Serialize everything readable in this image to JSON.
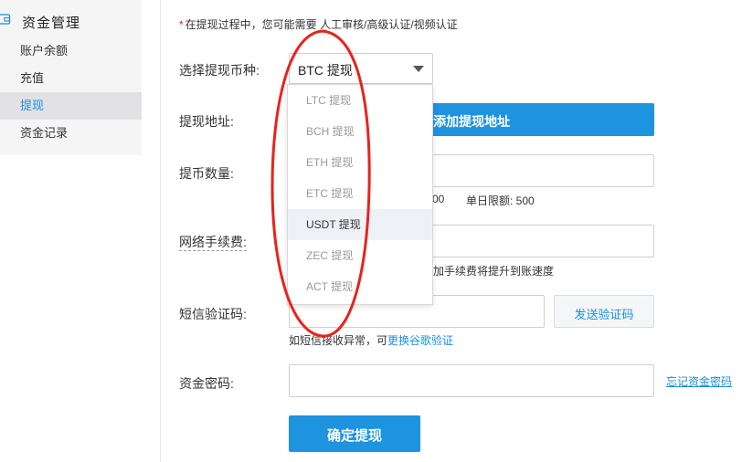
{
  "sidebar": {
    "title": "资金管理",
    "items": [
      {
        "label": "账户余额"
      },
      {
        "label": "充值"
      },
      {
        "label": "提现"
      },
      {
        "label": "资金记录"
      }
    ]
  },
  "form": {
    "notice_star": "*",
    "notice": "在提现过程中，您可能需要 人工审核/高级认证/视频认证",
    "currency_label": "选择提现币种:",
    "currency_value": "BTC 提现",
    "currency_options": [
      "LTC 提现",
      "BCH 提现",
      "ETH 提现",
      "ETC 提现",
      "USDT 提现",
      "ZEC 提现",
      "ACT 提现"
    ],
    "highlighted_option": "USDT 提现",
    "address_label": "提现地址:",
    "add_address_button": "+添加提现地址",
    "amount_label": "提币数量:",
    "amount_hint_partial": "00",
    "daily_limit": "单日限额: 500",
    "fee_label": "网络手续费:",
    "fee_hint_partial": "加手续费将提升到账速度",
    "sms_label": "短信验证码:",
    "send_code_button": "发送验证码",
    "sms_hint": "如短信接收异常，可",
    "sms_hint_link": "更换谷歌验证",
    "password_label": "资金密码:",
    "forgot_password_link": "忘记资金密码",
    "confirm_button": "确定提现"
  },
  "colors": {
    "accent": "#1e93e0",
    "link": "#1a8fdc",
    "annotation": "#e8231c"
  }
}
